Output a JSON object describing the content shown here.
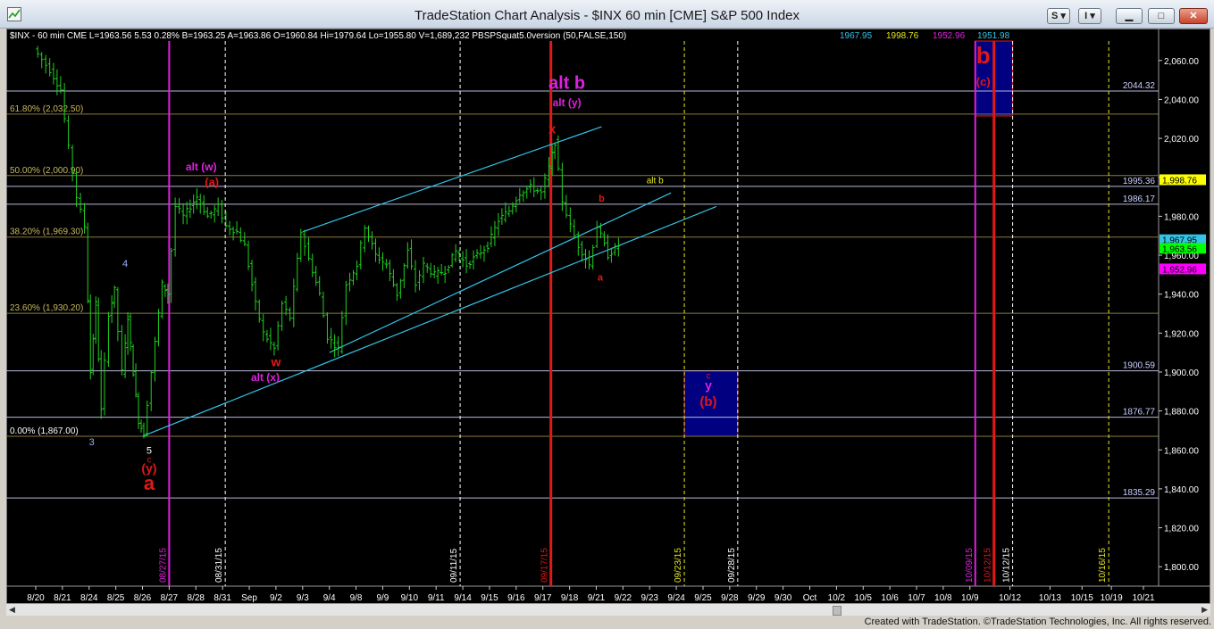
{
  "window": {
    "title": "TradeStation Chart Analysis - $INX 60 min [CME] S&P 500 Index",
    "btn_s": "S",
    "btn_i": "I"
  },
  "footer": {
    "credits": "Created with TradeStation. ©TradeStation Technologies, Inc. All rights reserved."
  },
  "colors": {
    "background": "#000000",
    "price_bars": "#1fd21f",
    "trendline": "#34c3e8",
    "wave_red": "#e01818",
    "wave_magenta": "#e020e0",
    "target_box": "#000080",
    "fib_line": "#8a7a3a",
    "level_line": "#b8b8d8"
  },
  "chart_data": {
    "type": "ohlc",
    "symbol_header": "$INX - 60 min  CME  L=1963.56  5.53   0.28%     B=1963.25  A=1963.86  O=1960.84  Hi=1979.64  Lo=1955.80  V=1,689,232  PBSPSquat5.0version (50,FALSE,150)",
    "indicator_values": [
      "1967.95",
      "1998.76",
      "1952.96",
      "1951.98"
    ],
    "indicator_colors": [
      "#34c3e8",
      "#e8e820",
      "#e020e0",
      "#34c3e8"
    ],
    "ylim": [
      1790,
      2070
    ],
    "y_ticks": [
      "1,800.00",
      "1,820.00",
      "1,840.00",
      "1,860.00",
      "1,880.00",
      "1,900.00",
      "1,920.00",
      "1,940.00",
      "1,960.00",
      "1,980.00",
      "2,000.00",
      "2,020.00",
      "2,040.00",
      "2,060.00"
    ],
    "x_axis_labels": [
      "8/20",
      "8/21",
      "8/24",
      "8/25",
      "8/26",
      "8/27",
      "8/28",
      "8/31",
      "Sep",
      "9/2",
      "9/3",
      "9/4",
      "9/8",
      "9/9",
      "9/10",
      "9/11",
      "9/14",
      "9/15",
      "9/16",
      "9/17",
      "9/18",
      "9/21",
      "9/22",
      "9/23",
      "9/24",
      "9/25",
      "9/28",
      "9/29",
      "9/30",
      "Oct",
      "10/2",
      "10/5",
      "10/6",
      "10/7",
      "10/8",
      "10/9",
      "10/12",
      "10/13",
      "10/15",
      "10/19",
      "10/21"
    ],
    "x_axis_slots": [
      0.0,
      1.0,
      2.0,
      3.0,
      4.0,
      5.0,
      6.0,
      7.0,
      8.0,
      9.0,
      10.0,
      11.0,
      12.0,
      13.0,
      14.0,
      15.0,
      16.0,
      17.0,
      18.0,
      19.0,
      20.0,
      21.0,
      22.0,
      23.0,
      24.0,
      25.0,
      26.0,
      27.0,
      28.0,
      29.0,
      30.0,
      31.0,
      32.0,
      33.0,
      34.0,
      35.0,
      36.5,
      38.0,
      39.2,
      40.3,
      41.5
    ],
    "vertical_date_labels": [
      {
        "date": "08/27/15",
        "slot": 5.0,
        "color": "#e020e0"
      },
      {
        "date": "08/31/15",
        "slot": 7.1,
        "color": "#ffffff"
      },
      {
        "date": "09/11/15",
        "slot": 15.9,
        "color": "#ffffff"
      },
      {
        "date": "09/17/15",
        "slot": 19.3,
        "color": "#e01818"
      },
      {
        "date": "09/23/15",
        "slot": 24.3,
        "color": "#e8e820"
      },
      {
        "date": "09/28/15",
        "slot": 26.3,
        "color": "#ffffff"
      },
      {
        "date": "10/09/15",
        "slot": 35.2,
        "color": "#e020e0"
      },
      {
        "date": "10/12/15",
        "slot": 35.9,
        "color": "#e01818"
      },
      {
        "date": "10/12/15",
        "slot": 36.6,
        "color": "#ffffff"
      },
      {
        "date": "10/16/15",
        "slot": 40.2,
        "color": "#e8e820"
      }
    ],
    "horizontal_levels": [
      {
        "label": "2044.32",
        "value": 2044.32
      },
      {
        "label": "1995.36",
        "value": 1995.36
      },
      {
        "label": "1986.17",
        "value": 1986.17
      },
      {
        "label": "1900.59",
        "value": 1900.59
      },
      {
        "label": "1876.77",
        "value": 1876.77
      },
      {
        "label": "1835.29",
        "value": 1835.29
      }
    ],
    "fib_levels": [
      {
        "label": "61.80% (2,032.50)",
        "value": 2032.5
      },
      {
        "label": "50.00% (2,000.90)",
        "value": 2000.9
      },
      {
        "label": "38.20% (1,969.30)",
        "value": 1969.3
      },
      {
        "label": "23.60% (1,930.20)",
        "value": 1930.2
      },
      {
        "label": "0.00% (1,867.00)",
        "value": 1867.0
      }
    ],
    "price_tags": [
      {
        "label": "1,998.76",
        "value": 1998.76,
        "bg": "#ffff00",
        "fg": "#000000"
      },
      {
        "label": "1,967.95",
        "value": 1967.95,
        "bg": "#34c3e8",
        "fg": "#000000"
      },
      {
        "label": "1,963.56",
        "value": 1963.56,
        "bg": "#00ff00",
        "fg": "#000000"
      },
      {
        "label": "1,952.96",
        "value": 1952.96,
        "bg": "#ff00ff",
        "fg": "#000000"
      }
    ],
    "path": [
      [
        0.0,
        2066
      ],
      [
        0.6,
        2055
      ],
      [
        1.0,
        2045
      ],
      [
        1.3,
        2015
      ],
      [
        1.6,
        1990
      ],
      [
        1.9,
        1975
      ],
      [
        2.1,
        1900
      ],
      [
        2.3,
        1935
      ],
      [
        2.5,
        1880
      ],
      [
        2.8,
        1930
      ],
      [
        3.0,
        1942
      ],
      [
        3.3,
        1900
      ],
      [
        3.5,
        1928
      ],
      [
        3.7,
        1900
      ],
      [
        3.9,
        1875
      ],
      [
        4.1,
        1868
      ],
      [
        4.4,
        1900
      ],
      [
        4.8,
        1945
      ],
      [
        5.0,
        1940
      ],
      [
        5.3,
        1985
      ],
      [
        5.6,
        1980
      ],
      [
        6.1,
        1990
      ],
      [
        6.5,
        1980
      ],
      [
        6.9,
        1985
      ],
      [
        7.2,
        1975
      ],
      [
        7.6,
        1972
      ],
      [
        7.9,
        1965
      ],
      [
        8.3,
        1935
      ],
      [
        8.6,
        1920
      ],
      [
        9.0,
        1912
      ],
      [
        9.3,
        1935
      ],
      [
        9.6,
        1928
      ],
      [
        10.0,
        1972
      ],
      [
        10.3,
        1958
      ],
      [
        10.7,
        1940
      ],
      [
        11.0,
        1918
      ],
      [
        11.4,
        1912
      ],
      [
        11.7,
        1945
      ],
      [
        12.1,
        1955
      ],
      [
        12.4,
        1975
      ],
      [
        12.8,
        1960
      ],
      [
        13.2,
        1955
      ],
      [
        13.6,
        1940
      ],
      [
        14.0,
        1962
      ],
      [
        14.3,
        1945
      ],
      [
        14.6,
        1955
      ],
      [
        15.0,
        1950
      ],
      [
        15.4,
        1952
      ],
      [
        15.8,
        1962
      ],
      [
        16.2,
        1955
      ],
      [
        16.6,
        1960
      ],
      [
        17.0,
        1965
      ],
      [
        17.4,
        1978
      ],
      [
        17.8,
        1983
      ],
      [
        18.2,
        1992
      ],
      [
        18.6,
        1995
      ],
      [
        19.0,
        1992
      ],
      [
        19.3,
        2005
      ],
      [
        19.5,
        2018
      ],
      [
        19.8,
        1988
      ],
      [
        20.1,
        1975
      ],
      [
        20.4,
        1965
      ],
      [
        20.8,
        1955
      ],
      [
        21.1,
        1975
      ],
      [
        21.5,
        1960
      ],
      [
        21.9,
        1965
      ]
    ],
    "trendlines": [
      {
        "x1": 4.0,
        "y1": 1867.0,
        "x2": 25.5,
        "y2": 1985.0
      },
      {
        "x1": 11.0,
        "y1": 1910.0,
        "x2": 23.8,
        "y2": 1992.0
      },
      {
        "x1": 10.0,
        "y1": 1972.0,
        "x2": 21.2,
        "y2": 2026.0
      }
    ],
    "vertical_markers": [
      {
        "slot": 5.0,
        "color": "#e020e0",
        "style": "solid",
        "width": 2
      },
      {
        "slot": 7.1,
        "color": "#ffffff",
        "style": "dashed",
        "width": 1
      },
      {
        "slot": 15.9,
        "color": "#ffffff",
        "style": "dashed",
        "width": 1
      },
      {
        "slot": 19.3,
        "color": "#e01818",
        "style": "solid",
        "width": 3
      },
      {
        "slot": 24.3,
        "color": "#e8e820",
        "style": "dashed",
        "width": 1
      },
      {
        "slot": 26.3,
        "color": "#ffffff",
        "style": "dashed",
        "width": 1
      },
      {
        "slot": 35.2,
        "color": "#e020e0",
        "style": "solid",
        "width": 2
      },
      {
        "slot": 35.9,
        "color": "#e01818",
        "style": "solid",
        "width": 3
      },
      {
        "slot": 36.6,
        "color": "#ffffff",
        "style": "dashed",
        "width": 1
      },
      {
        "slot": 40.2,
        "color": "#e8e820",
        "style": "dashed",
        "width": 1
      }
    ],
    "target_boxes": [
      {
        "x1": 24.3,
        "x2": 26.3,
        "y1": 1867.0,
        "y2": 1900.59
      },
      {
        "x1": 35.2,
        "x2": 36.6,
        "y1": 2031.5,
        "y2": 2070
      }
    ],
    "annotations": [
      {
        "text": "alt b",
        "x": 19.9,
        "y": 2045.5,
        "color": "#e020e0",
        "size": 20,
        "bold": true
      },
      {
        "text": "alt (y)",
        "x": 19.9,
        "y": 2036.5,
        "color": "#e020e0",
        "size": 12,
        "bold": true
      },
      {
        "text": "x",
        "x": 19.35,
        "y": 2022.5,
        "color": "#e01818",
        "size": 15,
        "bold": true
      },
      {
        "text": "alt (w)",
        "x": 6.2,
        "y": 2003.5,
        "color": "#e020e0",
        "size": 12,
        "bold": true
      },
      {
        "text": "(a)",
        "x": 6.6,
        "y": 1995.5,
        "color": "#e01818",
        "size": 13,
        "bold": true
      },
      {
        "text": "alt b",
        "x": 23.2,
        "y": 1997.0,
        "color": "#e8e820",
        "size": 10,
        "bold": false
      },
      {
        "text": "b",
        "x": 21.2,
        "y": 1987.5,
        "color": "#e01818",
        "size": 11,
        "bold": true
      },
      {
        "text": "a",
        "x": 21.15,
        "y": 1947.0,
        "color": "#e01818",
        "size": 11,
        "bold": true
      },
      {
        "text": "4",
        "x": 3.35,
        "y": 1954.0,
        "color": "#9ab0ff",
        "size": 11,
        "bold": false
      },
      {
        "text": "3",
        "x": 2.1,
        "y": 1862.5,
        "color": "#9ab0ff",
        "size": 11,
        "bold": false
      },
      {
        "text": "w",
        "x": 9.0,
        "y": 1903.0,
        "color": "#e01818",
        "size": 14,
        "bold": true
      },
      {
        "text": "alt (x)",
        "x": 8.6,
        "y": 1895.5,
        "color": "#e020e0",
        "size": 12,
        "bold": true
      },
      {
        "text": "c",
        "x": 25.2,
        "y": 1896.5,
        "color": "#e01818",
        "size": 10,
        "bold": false
      },
      {
        "text": "y",
        "x": 25.2,
        "y": 1891.0,
        "color": "#e020e0",
        "size": 14,
        "bold": true
      },
      {
        "text": "(b)",
        "x": 25.2,
        "y": 1882.5,
        "color": "#e01818",
        "size": 15,
        "bold": true
      },
      {
        "text": "5",
        "x": 4.25,
        "y": 1858.0,
        "color": "#ffffff",
        "size": 11,
        "bold": false
      },
      {
        "text": "c",
        "x": 4.25,
        "y": 1853.5,
        "color": "#e01818",
        "size": 10,
        "bold": false
      },
      {
        "text": "(y)",
        "x": 4.25,
        "y": 1848.5,
        "color": "#e01818",
        "size": 14,
        "bold": true
      },
      {
        "text": "a",
        "x": 4.25,
        "y": 1839.5,
        "color": "#e01818",
        "size": 22,
        "bold": true
      },
      {
        "text": "b",
        "x": 35.5,
        "y": 2058.5,
        "color": "#e01818",
        "size": 26,
        "bold": true
      },
      {
        "text": "(c)",
        "x": 35.5,
        "y": 2047.0,
        "color": "#e01818",
        "size": 13,
        "bold": true
      }
    ]
  }
}
